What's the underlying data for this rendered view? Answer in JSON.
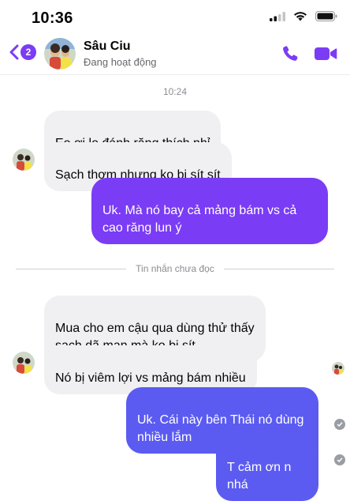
{
  "status_bar": {
    "time": "10:36"
  },
  "header": {
    "unread_count": "2",
    "contact_name": "Sâu Ciu",
    "contact_status": "Đang hoạt động"
  },
  "chat": {
    "timestamp": "10:24",
    "messages": [
      {
        "from": "them",
        "text": "Eo ơi lọ đánh răng thích nhỉ"
      },
      {
        "from": "them",
        "text": "Sạch thơm nhưng ko bị sít sít"
      },
      {
        "from": "me",
        "text": "Uk. Mà nó bay cả mảng bám vs cả\ncao răng lun ý"
      },
      {
        "from": "them",
        "text": "Mua cho em cậu qua dùng thử thấy\nsạch dã man mà ko bị sít"
      },
      {
        "from": "them",
        "text": "Nó bị viêm lợi vs mảng bám nhiều"
      },
      {
        "from": "me",
        "text": "Uk. Cái này bên Thái nó dùng\nnhiều lắm"
      },
      {
        "from": "me",
        "text": "T cảm ơn n nhá"
      }
    ],
    "unread_divider": "Tin nhắn chưa đọc"
  },
  "colors": {
    "accent": "#7b3cf5",
    "outgoing_bubble": "#7b3cf5",
    "outgoing_bubble_2": "#5b5bf2",
    "incoming_bubble": "#f0f0f2"
  }
}
